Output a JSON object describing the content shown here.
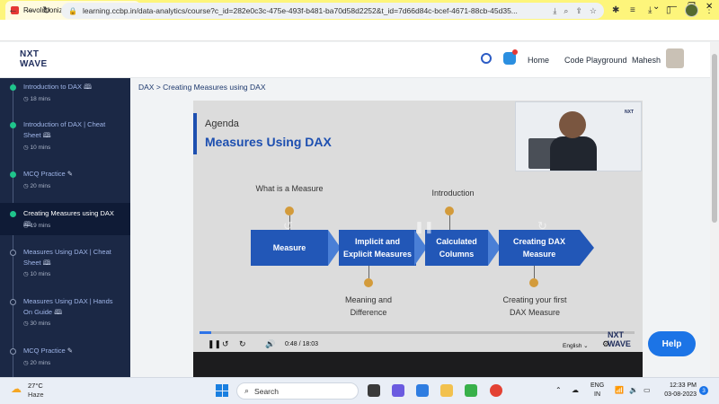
{
  "browser": {
    "tab_title": "Revolutionizing the Job Mark",
    "new_tab_label": "+",
    "url": "learning.ccbp.in/data-analytics/course?c_id=282e0c3c-475e-493f-b481-ba70d58d2252&t_id=7d66d84c-bcef-4671-88cb-45d35..."
  },
  "header": {
    "logo_line1": "NXT",
    "logo_line2": "WAVE",
    "nav": [
      "Home",
      "Code Playground"
    ],
    "user_name": "Mahesh"
  },
  "sidebar": {
    "items": [
      {
        "title": "Introduction to DAX",
        "time": "18 mins",
        "state": "done",
        "icon": "book"
      },
      {
        "title": "Introduction of DAX | Cheat Sheet",
        "time": "10 mins",
        "state": "done",
        "icon": "book"
      },
      {
        "title": "MCQ Practice",
        "time": "20 mins",
        "state": "done",
        "icon": "pencil"
      },
      {
        "title": "Creating Measures using DAX",
        "time": "19 mins",
        "state": "current",
        "icon": "book"
      },
      {
        "title": "Measures Using DAX | Cheat Sheet",
        "time": "10 mins",
        "state": "open",
        "icon": "book"
      },
      {
        "title": "Measures Using DAX | Hands On Guide",
        "time": "30 mins",
        "state": "open",
        "icon": "book"
      },
      {
        "title": "MCQ Practice",
        "time": "20 mins",
        "state": "open",
        "icon": "pencil"
      }
    ]
  },
  "breadcrumb": "DAX > Creating Measures using DAX",
  "slide": {
    "agenda": "Agenda",
    "title": "Measures Using DAX",
    "top_labels": [
      "What is a Measure",
      "Introduction"
    ],
    "steps": [
      "Measure",
      "Implicit and Explicit Measures",
      "Calculated Columns",
      "Creating DAX Measure"
    ],
    "bottom_labels": [
      "Meaning and Difference",
      "Creating your first DAX Measure"
    ]
  },
  "player": {
    "current_time": "0:48",
    "duration": "18:03",
    "progress": 0.027,
    "language": "English",
    "watermark_line1": "NXT",
    "watermark_line2": "WAVE"
  },
  "help_label": "Help",
  "taskbar": {
    "temperature": "27°C",
    "condition": "Haze",
    "search_placeholder": "Search",
    "lang_line1": "ENG",
    "lang_line2": "IN",
    "time": "12:33 PM",
    "date": "03-08-2023",
    "notification_count": "3"
  },
  "colors": {
    "sidebar_bg": "#1b2845",
    "step_blue": "#2257b7",
    "accent_green": "#1fc48b",
    "marker_orange": "#d39b3b",
    "help_blue": "#1c74e6"
  }
}
